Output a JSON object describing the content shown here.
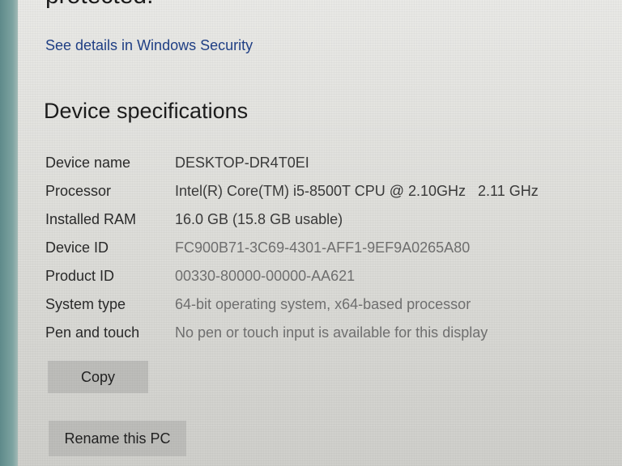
{
  "top": {
    "cut_heading": "protected.",
    "security_link": "See details in Windows Security"
  },
  "specs": {
    "title": "Device specifications",
    "rows": [
      {
        "label": "Device name",
        "value": "DESKTOP-DR4T0EI"
      },
      {
        "label": "Processor",
        "value": "Intel(R) Core(TM) i5-8500T CPU @ 2.10GHz   2.11 GHz"
      },
      {
        "label": "Installed RAM",
        "value": "16.0 GB (15.8 GB usable)"
      },
      {
        "label": "Device ID",
        "value": "FC900B71-3C69-4301-AFF1-9EF9A0265A80"
      },
      {
        "label": "Product ID",
        "value": "00330-80000-00000-AA621"
      },
      {
        "label": "System type",
        "value": "64-bit operating system, x64-based processor"
      },
      {
        "label": "Pen and touch",
        "value": "No pen or touch input is available for this display"
      }
    ]
  },
  "buttons": {
    "copy": "Copy",
    "rename": "Rename this PC"
  },
  "colors": {
    "link": "#1f3f86",
    "button_bg": "#bdbdba",
    "edge": "#6e9897"
  }
}
